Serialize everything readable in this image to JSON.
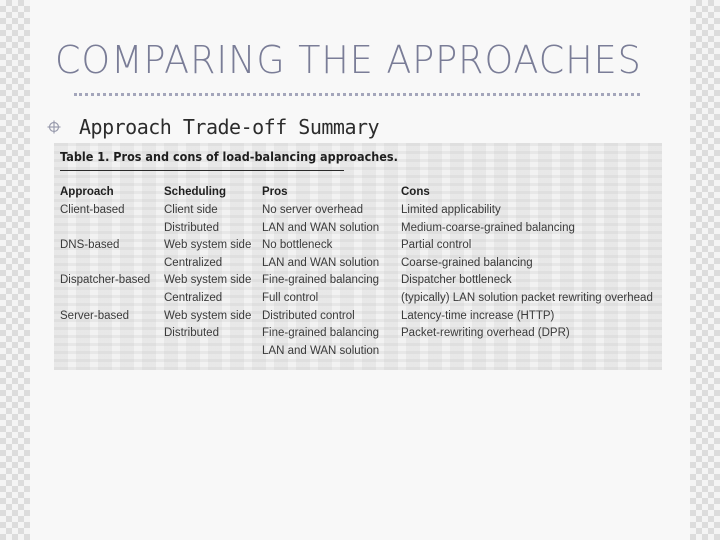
{
  "slide": {
    "title": "COMPARING THE APPROACHES",
    "bullet": {
      "icon": "crosshair-bullet-icon",
      "text": "Approach Trade-off Summary"
    }
  },
  "table": {
    "caption": "Table 1. Pros and cons of load-balancing approaches.",
    "headers": [
      "Approach",
      "Scheduling",
      "Pros",
      "Cons"
    ],
    "rows": [
      [
        "Client-based",
        "Client side",
        "No server overhead",
        "Limited applicability"
      ],
      [
        "",
        "Distributed",
        "LAN and WAN solution",
        "Medium-coarse-grained balancing"
      ],
      [
        "DNS-based",
        "Web system side",
        "No bottleneck",
        "Partial control"
      ],
      [
        "",
        "Centralized",
        "LAN and WAN solution",
        "Coarse-grained balancing"
      ],
      [
        "Dispatcher-based",
        "Web system side",
        "Fine-grained balancing",
        "Dispatcher bottleneck"
      ],
      [
        "",
        "Centralized",
        "Full control",
        "(typically) LAN solution packet rewriting overhead"
      ],
      [
        "Server-based",
        "Web system side",
        "Distributed control",
        "Latency-time increase (HTTP)"
      ],
      [
        "",
        "Distributed",
        "Fine-grained balancing",
        "Packet-rewriting overhead (DPR)"
      ],
      [
        "",
        "",
        "LAN and WAN solution",
        ""
      ]
    ]
  },
  "colors": {
    "title": "#7a7d97",
    "divider": "#a4a6bb",
    "background": "#f8f8f8"
  }
}
